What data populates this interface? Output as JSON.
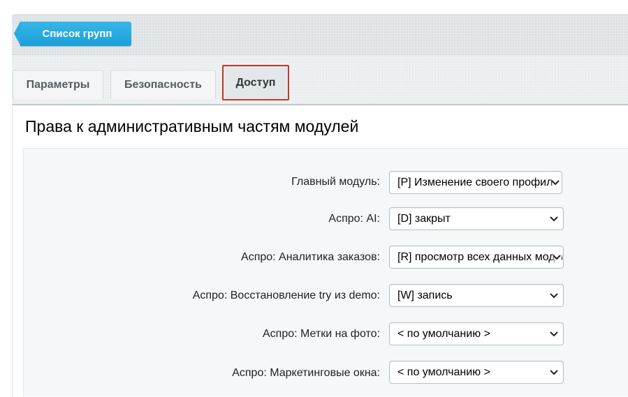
{
  "toolbar": {
    "back_label": "Список групп"
  },
  "tabs": [
    {
      "label": "Параметры"
    },
    {
      "label": "Безопасность"
    },
    {
      "label": "Доступ"
    }
  ],
  "section": {
    "title": "Права к административным частям модулей"
  },
  "rows": [
    {
      "label": "Главный модуль:",
      "value": "[P] Изменение своего профиля"
    },
    {
      "label": "Аспро: AI:",
      "value": "[D] закрыт"
    },
    {
      "label": "Аспро: Аналитика заказов:",
      "value": "[R] просмотр всех данных модуля"
    },
    {
      "label": "Аспро: Восстановление try из demo:",
      "value": "[W] запись"
    },
    {
      "label": "Аспро: Метки на фото:",
      "value": "< по умолчанию >"
    },
    {
      "label": "Аспро: Маркетинговые окна:",
      "value": "< по умолчанию >"
    }
  ],
  "colors": {
    "accent": "#1ea3dc",
    "active_tab_border": "#c0392b"
  }
}
